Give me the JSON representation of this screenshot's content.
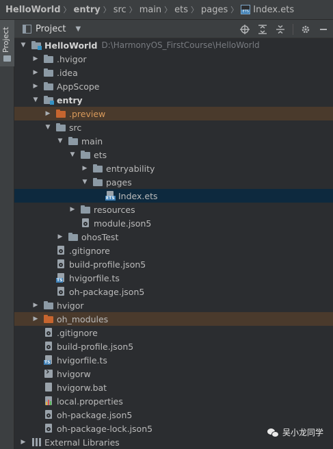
{
  "breadcrumb": [
    "HelloWorld",
    "entry",
    "src",
    "main",
    "ets",
    "pages",
    "Index.ets"
  ],
  "stripe": {
    "project_tab": "Project"
  },
  "panel": {
    "title": "Project",
    "dropdown_glyph": "▼",
    "toolbar_icons": [
      "locate-icon",
      "expand-all-icon",
      "collapse-all-icon",
      "settings-icon",
      "hide-icon"
    ]
  },
  "tree": [
    {
      "label": "HelloWorld",
      "path": "D:\\HarmonyOS_FirstCourse\\HelloWorld",
      "depth": 0,
      "expander": "open",
      "icon": "module-folder",
      "bold": true
    },
    {
      "label": ".hvigor",
      "depth": 1,
      "expander": "closed",
      "icon": "folder"
    },
    {
      "label": ".idea",
      "depth": 1,
      "expander": "closed",
      "icon": "folder"
    },
    {
      "label": "AppScope",
      "depth": 1,
      "expander": "closed",
      "icon": "folder"
    },
    {
      "label": "entry",
      "depth": 1,
      "expander": "open",
      "icon": "module-folder",
      "bold": true
    },
    {
      "label": ".preview",
      "depth": 2,
      "expander": "closed",
      "icon": "folder-orange",
      "orange": true,
      "highlight": "excluded"
    },
    {
      "label": "src",
      "depth": 2,
      "expander": "open",
      "icon": "folder"
    },
    {
      "label": "main",
      "depth": 3,
      "expander": "open",
      "icon": "folder"
    },
    {
      "label": "ets",
      "depth": 4,
      "expander": "open",
      "icon": "folder"
    },
    {
      "label": "entryability",
      "depth": 5,
      "expander": "closed",
      "icon": "folder"
    },
    {
      "label": "pages",
      "depth": 5,
      "expander": "open",
      "icon": "folder"
    },
    {
      "label": "Index.ets",
      "depth": 6,
      "expander": "none",
      "icon": "ets-file",
      "selected": true
    },
    {
      "label": "resources",
      "depth": 4,
      "expander": "closed",
      "icon": "folder"
    },
    {
      "label": "module.json5",
      "depth": 4,
      "expander": "none",
      "icon": "json-file"
    },
    {
      "label": "ohosTest",
      "depth": 3,
      "expander": "closed",
      "icon": "folder"
    },
    {
      "label": ".gitignore",
      "depth": 2,
      "expander": "none",
      "icon": "gitignore-file"
    },
    {
      "label": "build-profile.json5",
      "depth": 2,
      "expander": "none",
      "icon": "json-file"
    },
    {
      "label": "hvigorfile.ts",
      "depth": 2,
      "expander": "none",
      "icon": "ts-file"
    },
    {
      "label": "oh-package.json5",
      "depth": 2,
      "expander": "none",
      "icon": "json-file"
    },
    {
      "label": "hvigor",
      "depth": 1,
      "expander": "closed",
      "icon": "folder"
    },
    {
      "label": "oh_modules",
      "depth": 1,
      "expander": "closed",
      "icon": "folder-orange",
      "highlight": "excluded"
    },
    {
      "label": ".gitignore",
      "depth": 1,
      "expander": "none",
      "icon": "gitignore-file"
    },
    {
      "label": "build-profile.json5",
      "depth": 1,
      "expander": "none",
      "icon": "json-file"
    },
    {
      "label": "hvigorfile.ts",
      "depth": 1,
      "expander": "none",
      "icon": "ts-file"
    },
    {
      "label": "hvigorw",
      "depth": 1,
      "expander": "none",
      "icon": "terminal-file"
    },
    {
      "label": "hvigorw.bat",
      "depth": 1,
      "expander": "none",
      "icon": "bat-file"
    },
    {
      "label": "local.properties",
      "depth": 1,
      "expander": "none",
      "icon": "properties-file"
    },
    {
      "label": "oh-package.json5",
      "depth": 1,
      "expander": "none",
      "icon": "json-file"
    },
    {
      "label": "oh-package-lock.json5",
      "depth": 1,
      "expander": "none",
      "icon": "json-file"
    },
    {
      "label": "External Libraries",
      "depth": 0,
      "expander": "closed",
      "icon": "library"
    }
  ],
  "watermark": {
    "text": "吴小龙同学"
  },
  "colors": {
    "background": "#2b2d30",
    "selected_row": "#0d293e",
    "excluded_row": "#4a3a2c",
    "module_badge": "#3592c4",
    "excluded_folder": "#c7652f"
  }
}
